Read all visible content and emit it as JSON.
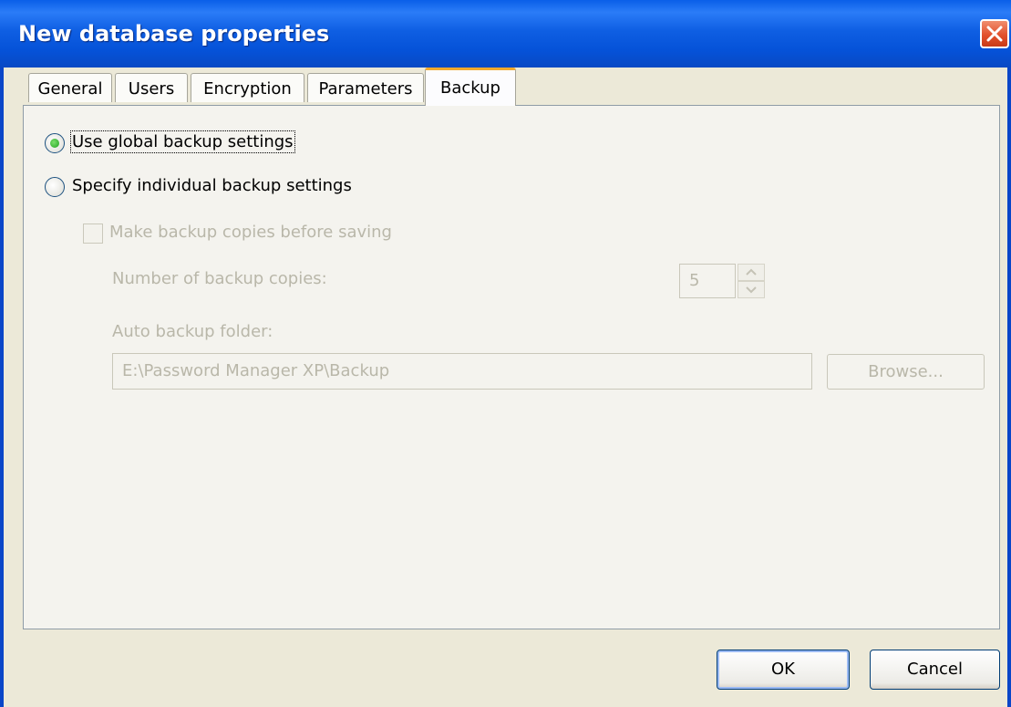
{
  "window": {
    "title": "New database properties"
  },
  "tabs": [
    {
      "label": "General",
      "active": false
    },
    {
      "label": "Users",
      "active": false
    },
    {
      "label": "Encryption",
      "active": false
    },
    {
      "label": "Parameters",
      "active": false
    },
    {
      "label": "Backup",
      "active": true
    }
  ],
  "backup": {
    "use_global_label": "Use global backup settings",
    "use_global_selected": true,
    "specify_individual_label": "Specify individual backup settings",
    "specify_individual_selected": false,
    "make_copies_label": "Make backup copies before saving",
    "make_copies_checked": false,
    "number_of_copies_label": "Number of backup copies:",
    "number_of_copies_value": "5",
    "folder_label": "Auto backup folder:",
    "folder_value": "E:\\Password Manager XP\\Backup",
    "browse_label": "Browse..."
  },
  "buttons": {
    "ok_label": "OK",
    "cancel_label": "Cancel"
  },
  "colors": {
    "titlebar": "#0552d8",
    "active_tab_accent": "#f3a92c",
    "radio_dot": "#21a121",
    "disabled_text": "#b9b7a9"
  }
}
